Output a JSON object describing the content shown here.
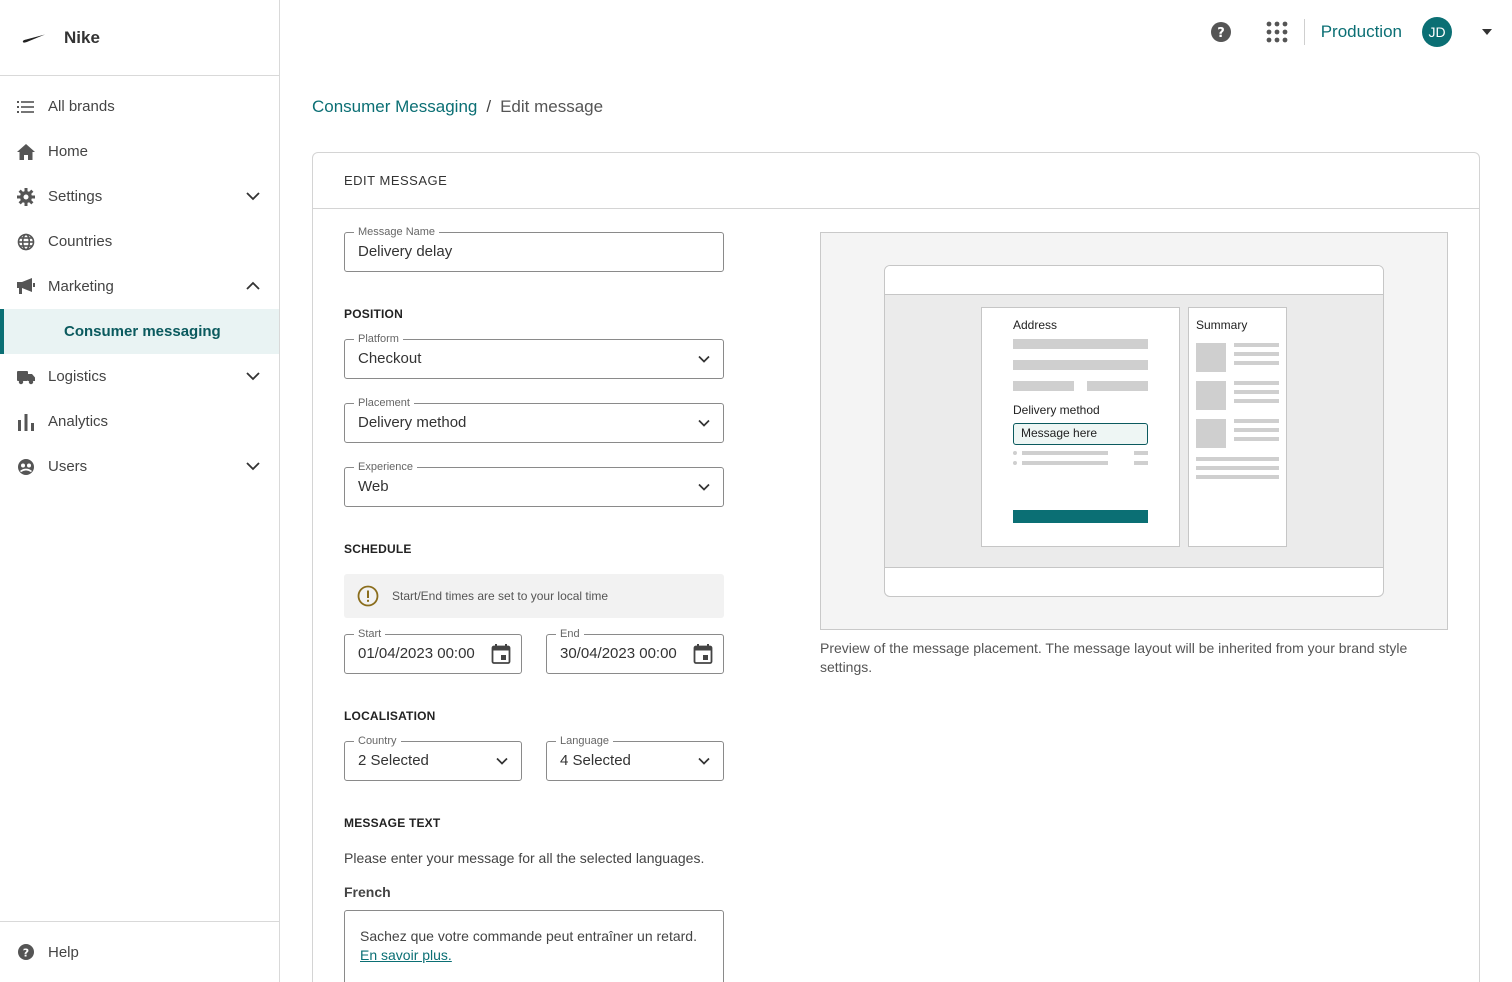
{
  "brand": {
    "name": "Nike"
  },
  "sidebar": {
    "items": [
      {
        "label": "All brands",
        "icon": "list-icon"
      },
      {
        "label": "Home",
        "icon": "home-icon"
      },
      {
        "label": "Settings",
        "icon": "gear-icon"
      },
      {
        "label": "Countries",
        "icon": "globe-icon"
      },
      {
        "label": "Marketing",
        "icon": "megaphone-icon"
      },
      {
        "label": "Consumer messaging"
      },
      {
        "label": "Logistics",
        "icon": "truck-icon"
      },
      {
        "label": "Analytics",
        "icon": "bar-chart-icon"
      },
      {
        "label": "Users",
        "icon": "users-icon"
      }
    ],
    "help_label": "Help"
  },
  "topbar": {
    "environment": "Production",
    "avatar_initials": "JD"
  },
  "breadcrumb": {
    "parent": "Consumer Messaging",
    "separator": "/",
    "current": "Edit message"
  },
  "card": {
    "title": "EDIT MESSAGE"
  },
  "form": {
    "message_name": {
      "label": "Message Name",
      "value": "Delivery delay"
    },
    "position_title": "POSITION",
    "platform": {
      "label": "Platform",
      "value": "Checkout"
    },
    "placement": {
      "label": "Placement",
      "value": "Delivery method"
    },
    "experience": {
      "label": "Experience",
      "value": "Web"
    },
    "schedule_title": "SCHEDULE",
    "schedule_notice": "Start/End times are set to your local time",
    "start": {
      "label": "Start",
      "value": "01/04/2023 00:00"
    },
    "end": {
      "label": "End",
      "value": "30/04/2023 00:00"
    },
    "localisation_title": "LOCALISATION",
    "country": {
      "label": "Country",
      "value": "2 Selected"
    },
    "language": {
      "label": "Language",
      "value": "4 Selected"
    },
    "message_text_title": "MESSAGE TEXT",
    "message_intro": "Please enter your message for all the selected languages.",
    "french_label": "French",
    "french_text": "Sachez que votre commande peut entraîner un retard.",
    "french_link": "En savoir plus."
  },
  "preview": {
    "address_label": "Address",
    "delivery_method_label": "Delivery method",
    "message_placeholder": "Message here",
    "summary_label": "Summary",
    "caption": "Preview of the message placement. The message layout will be inherited from your brand style settings."
  },
  "colors": {
    "accent": "#0b6f74",
    "active_bg": "#e9f3f3",
    "warning": "#8a6d1c"
  }
}
